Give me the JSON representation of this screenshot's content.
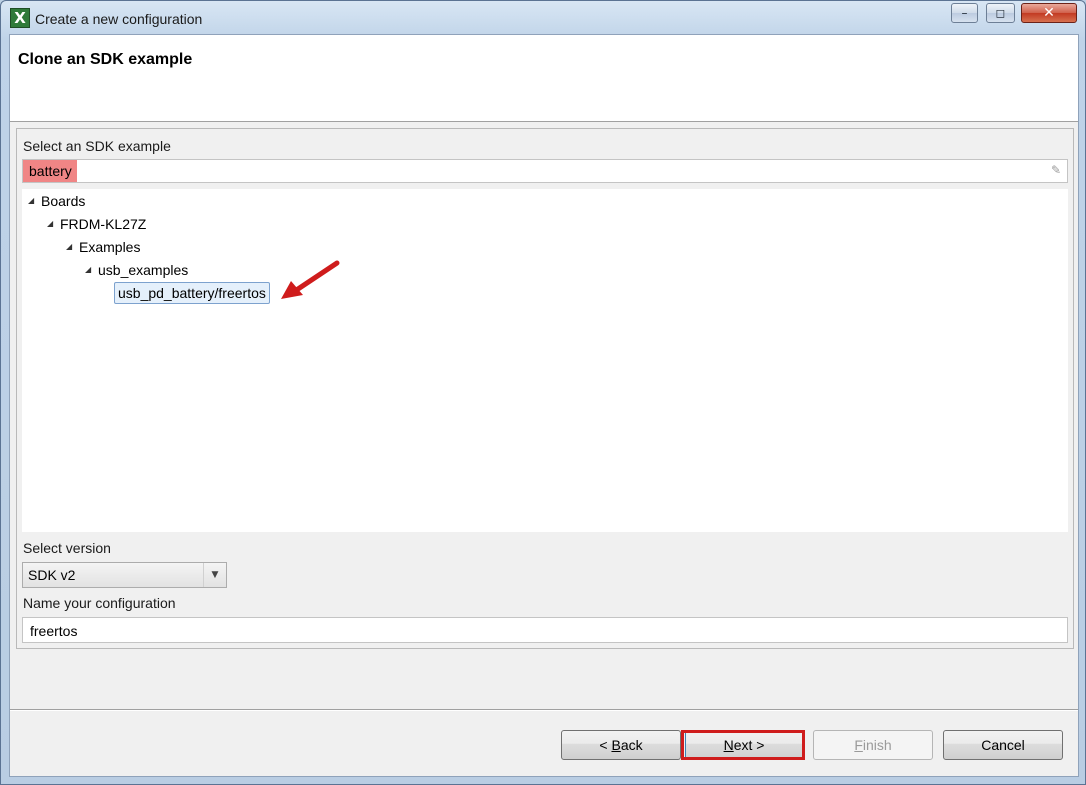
{
  "window": {
    "title": "Create a new configuration",
    "icon_glyph": "X",
    "controls": {
      "minimize": "–",
      "maximize": "◻",
      "close": "✕"
    }
  },
  "header": {
    "title": "Clone an SDK example"
  },
  "example_section": {
    "label": "Select an SDK example",
    "filter_value": "battery",
    "filter_highlight_color": "#f08585",
    "clear_icon": "✎"
  },
  "tree": {
    "items": [
      {
        "label": "Boards",
        "level": 0,
        "expanded": true
      },
      {
        "label": "FRDM-KL27Z",
        "level": 1,
        "expanded": true
      },
      {
        "label": "Examples",
        "level": 2,
        "expanded": true
      },
      {
        "label": "usb_examples",
        "level": 3,
        "expanded": true
      },
      {
        "label": "usb_pd_battery/freertos",
        "level": 4,
        "selected": true
      }
    ],
    "twisty_glyph": "◢"
  },
  "version_section": {
    "label": "Select version",
    "selected": "SDK v2",
    "arrow": "▼"
  },
  "name_section": {
    "label": "Name your configuration",
    "value": "freertos"
  },
  "buttons": {
    "back_mnemonic": "B",
    "back_rest": "ack",
    "back_prefix": "< ",
    "next_mnemonic": "N",
    "next_rest": "ext >",
    "finish_mnemonic": "F",
    "finish_rest": "inish",
    "cancel": "Cancel"
  },
  "annotation_color": "#cf1c1c"
}
